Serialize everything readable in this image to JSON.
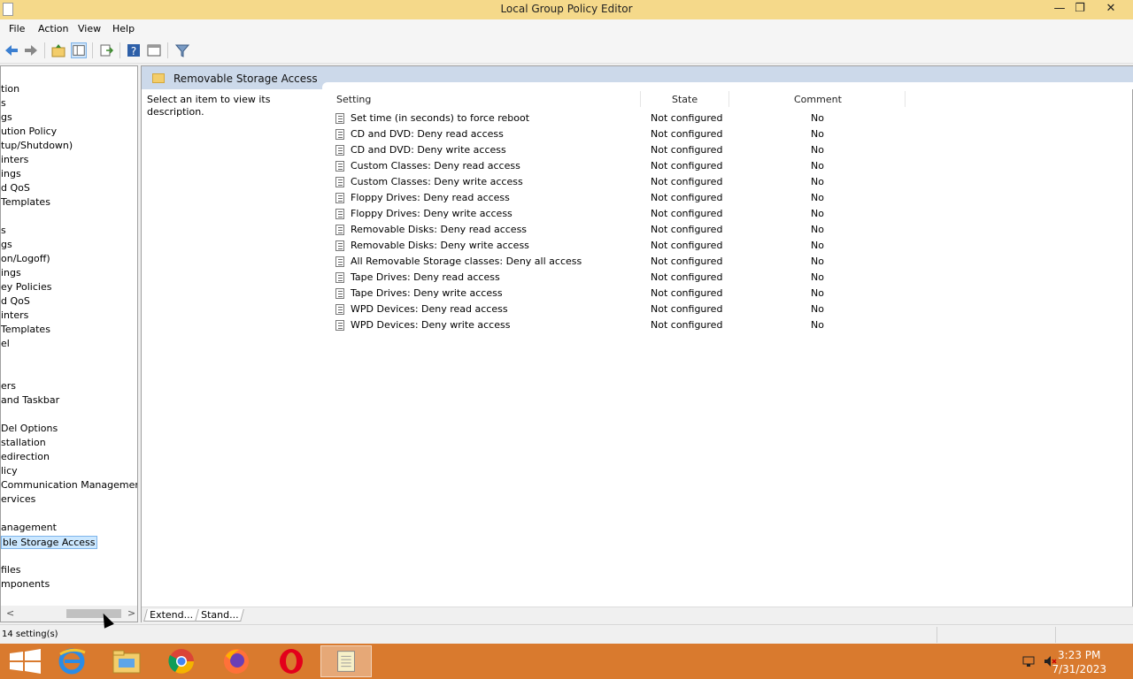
{
  "window": {
    "title": "Local Group Policy Editor",
    "minimize": "—",
    "restore": "❐",
    "close": "✕"
  },
  "menu": [
    "File",
    "Action",
    "View",
    "Help"
  ],
  "tree": {
    "items": [
      "tion",
      "s",
      "gs",
      "ution Policy",
      "tup/Shutdown)",
      "inters",
      "ings",
      "d QoS",
      "Templates",
      "s",
      "gs",
      "on/Logoff)",
      "ings",
      "ey Policies",
      "d QoS",
      "inters",
      "Templates",
      "el",
      "ers",
      "and Taskbar",
      "Del Options",
      "stallation",
      "edirection",
      "licy",
      "Communication Managemer",
      "ervices",
      "anagement",
      "ble Storage Access",
      "files",
      "mponents"
    ],
    "selected_index": 27,
    "scroll_left": "<",
    "scroll_right": ">"
  },
  "main": {
    "folder_title": "Removable Storage Access",
    "description": "Select an item to view its description.",
    "columns": {
      "setting": "Setting",
      "state": "State",
      "comment": "Comment"
    },
    "rows": [
      {
        "name": "Set time (in seconds) to force reboot",
        "state": "Not configured",
        "comment": "No"
      },
      {
        "name": "CD and DVD: Deny read access",
        "state": "Not configured",
        "comment": "No"
      },
      {
        "name": "CD and DVD: Deny write access",
        "state": "Not configured",
        "comment": "No"
      },
      {
        "name": "Custom Classes: Deny read access",
        "state": "Not configured",
        "comment": "No"
      },
      {
        "name": "Custom Classes: Deny write access",
        "state": "Not configured",
        "comment": "No"
      },
      {
        "name": "Floppy Drives: Deny read access",
        "state": "Not configured",
        "comment": "No"
      },
      {
        "name": "Floppy Drives: Deny write access",
        "state": "Not configured",
        "comment": "No"
      },
      {
        "name": "Removable Disks: Deny read access",
        "state": "Not configured",
        "comment": "No"
      },
      {
        "name": "Removable Disks: Deny write access",
        "state": "Not configured",
        "comment": "No"
      },
      {
        "name": "All Removable Storage classes: Deny all access",
        "state": "Not configured",
        "comment": "No"
      },
      {
        "name": "Tape Drives: Deny read access",
        "state": "Not configured",
        "comment": "No"
      },
      {
        "name": "Tape Drives: Deny write access",
        "state": "Not configured",
        "comment": "No"
      },
      {
        "name": "WPD Devices: Deny read access",
        "state": "Not configured",
        "comment": "No"
      },
      {
        "name": "WPD Devices: Deny write access",
        "state": "Not configured",
        "comment": "No"
      }
    ],
    "bottom_tabs": [
      "Extend...",
      "Stand..."
    ]
  },
  "status": {
    "text": "14 setting(s)"
  },
  "taskbar": {
    "apps": [
      "start-icon",
      "internet-explorer-icon",
      "file-explorer-icon",
      "chrome-icon",
      "firefox-icon",
      "opera-icon",
      "notepad-icon"
    ],
    "time": "3:23 PM",
    "date": "7/31/2023"
  },
  "colors": {
    "titlebar": "#f5d98a",
    "taskbar": "#d97a2e",
    "header_band": "#ccd9ea",
    "selection": "#cce8ff"
  }
}
